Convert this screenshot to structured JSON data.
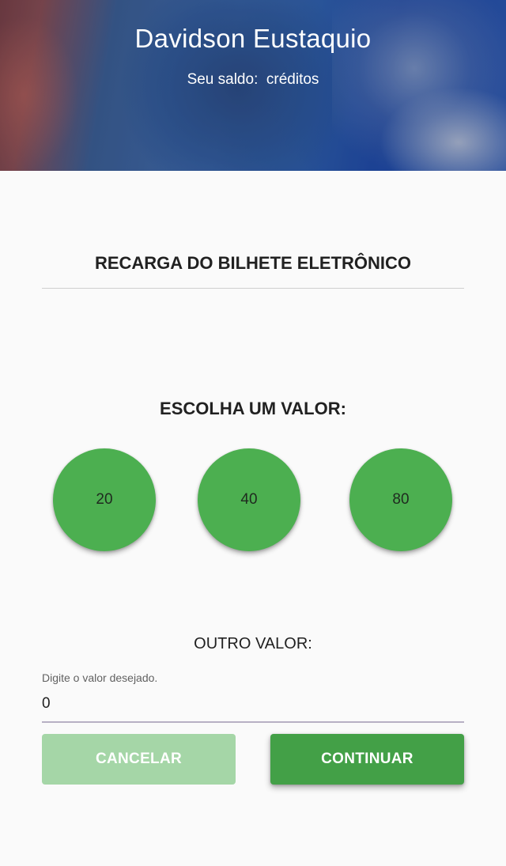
{
  "header": {
    "user_name": "Davidson Eustaquio",
    "balance_text": "Seu saldo:  créditos"
  },
  "main": {
    "title": "RECARGA DO BILHETE ELETRÔNICO",
    "choose_label": "ESCOLHA UM VALOR:",
    "values": [
      "20",
      "40",
      "80"
    ],
    "other_label": "OUTRO VALOR:",
    "input_label": "Digite o valor desejado.",
    "input_value": "0"
  },
  "actions": {
    "cancel_label": "CANCELAR",
    "continue_label": "CONTINUAR"
  },
  "colors": {
    "accent": "#4caf50",
    "button_primary": "#43a047",
    "button_disabled": "#a5d6a7"
  }
}
